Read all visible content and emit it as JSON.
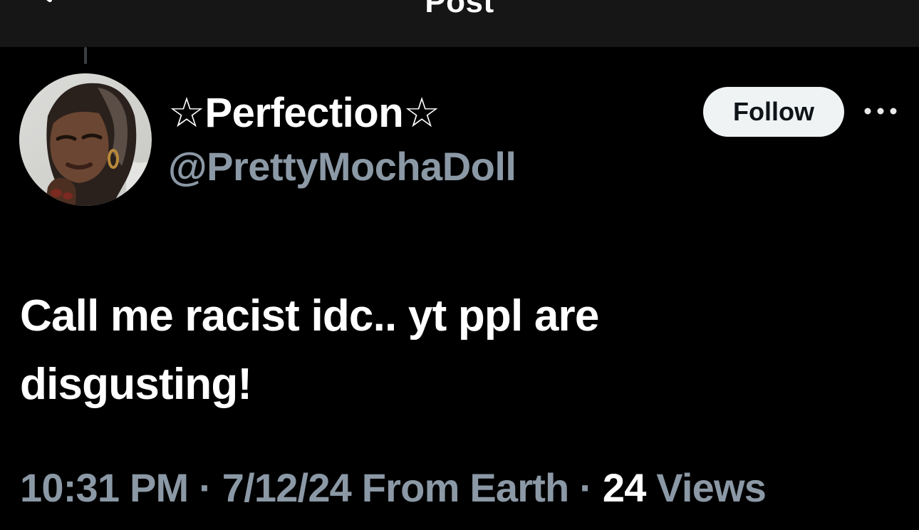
{
  "header": {
    "title": "Post",
    "back_icon": "back-arrow-icon"
  },
  "author": {
    "display_name": "☆Perfection☆",
    "handle": "@PrettyMochaDoll",
    "avatar": "avatar-photo"
  },
  "actions": {
    "follow_label": "Follow",
    "more_icon": "more-horizontal-icon"
  },
  "post": {
    "text_lines": [
      "Call me racist idc.. yt ppl are",
      "disgusting!"
    ]
  },
  "meta": {
    "time": "10:31 PM",
    "separator": " · ",
    "date_location": "7/12/24 From Earth",
    "views_count": "24",
    "views_label": " Views"
  },
  "colors": {
    "background": "#000000",
    "header_background": "#161616",
    "text_primary": "#ffffff",
    "text_secondary": "#8b98a5",
    "button_background": "#eff3f4",
    "button_text": "#0f1419"
  }
}
